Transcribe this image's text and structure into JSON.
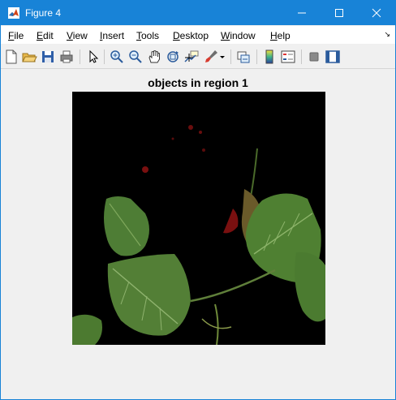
{
  "window": {
    "title": "Figure 4"
  },
  "menu": [
    {
      "label": "File",
      "key": "F",
      "rest": "ile"
    },
    {
      "label": "Edit",
      "key": "E",
      "rest": "dit"
    },
    {
      "label": "View",
      "key": "V",
      "rest": "iew"
    },
    {
      "label": "Insert",
      "key": "I",
      "rest": "nsert"
    },
    {
      "label": "Tools",
      "key": "T",
      "rest": "ools"
    },
    {
      "label": "Desktop",
      "key": "D",
      "rest": "esktop"
    },
    {
      "label": "Window",
      "key": "W",
      "rest": "indow"
    },
    {
      "label": "Help",
      "key": "H",
      "rest": "elp"
    }
  ],
  "toolbar": [
    "new-figure-icon",
    "open-file-icon",
    "save-icon",
    "print-icon",
    "edit-plot-arrow-icon",
    "zoom-in-icon",
    "zoom-out-icon",
    "pan-hand-icon",
    "rotate-3d-icon",
    "data-cursor-icon",
    "brush-icon",
    "link-plot-icon",
    "insert-colorbar-icon",
    "insert-legend-icon",
    "hide-plot-tools-icon",
    "show-plot-tools-icon"
  ],
  "axes": {
    "title": "objects in region 1"
  },
  "colors": {
    "titlebar": "#1883d7",
    "figure_bg": "#f0f0f0",
    "image_bg": "#000000",
    "leaf": "#4e7d35",
    "petal": "#7a1010"
  }
}
